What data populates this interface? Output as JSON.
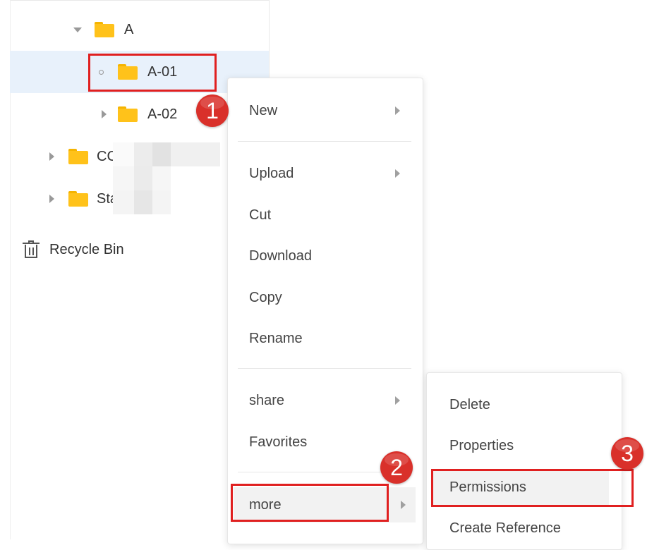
{
  "tree": {
    "items": [
      {
        "label": "A",
        "state": "expanded",
        "icon": "folder-icon"
      },
      {
        "label": "A-01",
        "state": "leaf",
        "icon": "folder-icon"
      },
      {
        "label": "A-02",
        "state": "collapsed",
        "icon": "folder-icon"
      },
      {
        "label": "CC",
        "state": "collapsed",
        "icon": "folder-icon"
      },
      {
        "label": "Sta",
        "state": "collapsed",
        "icon": "folder-icon"
      }
    ],
    "recycle_bin": "Recycle Bin",
    "folder_color": "#ffc21a",
    "selected_color": "#e8f1fb"
  },
  "context_menu": {
    "items": {
      "new": "New",
      "upload": "Upload",
      "cut": "Cut",
      "download": "Download",
      "copy": "Copy",
      "rename": "Rename",
      "share": "share",
      "favorites": "Favorites",
      "more": "more"
    }
  },
  "sub_menu": {
    "items": {
      "delete": "Delete",
      "properties": "Properties",
      "permissions": "Permissions",
      "create_reference": "Create Reference"
    }
  },
  "annotations": {
    "step1": "1",
    "step2": "2",
    "step3": "3",
    "highlight_color": "#e02020",
    "badge_color": "#d9302a"
  }
}
